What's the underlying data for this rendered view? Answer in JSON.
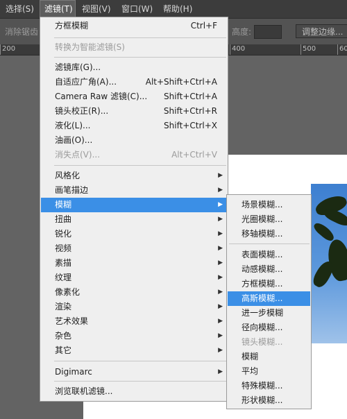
{
  "menubar": {
    "items": [
      {
        "label": "选择(S)"
      },
      {
        "label": "滤镜(T)"
      },
      {
        "label": "视图(V)"
      },
      {
        "label": "窗口(W)"
      },
      {
        "label": "帮助(H)"
      }
    ]
  },
  "options_bar": {
    "antialias_label": "消除锯齿",
    "height_label": "高度:",
    "height_value": "",
    "refine_edge_label": "调整边缘..."
  },
  "ruler": {
    "ticks": [
      "200",
      "400",
      "500",
      "600"
    ]
  },
  "filter_menu": {
    "last_filter": {
      "label": "方框模糊",
      "shortcut": "Ctrl+F"
    },
    "convert_smart": {
      "label": "转换为智能滤镜(S)"
    },
    "group1": [
      {
        "label": "滤镜库(G)...",
        "shortcut": ""
      },
      {
        "label": "自适应广角(A)...",
        "shortcut": "Alt+Shift+Ctrl+A"
      },
      {
        "label": "Camera Raw 滤镜(C)...",
        "shortcut": "Shift+Ctrl+A"
      },
      {
        "label": "镜头校正(R)...",
        "shortcut": "Shift+Ctrl+R"
      },
      {
        "label": "液化(L)...",
        "shortcut": "Shift+Ctrl+X"
      },
      {
        "label": "油画(O)...",
        "shortcut": ""
      },
      {
        "label": "消失点(V)...",
        "shortcut": "Alt+Ctrl+V"
      }
    ],
    "submenus": [
      {
        "label": "风格化"
      },
      {
        "label": "画笔描边"
      },
      {
        "label": "模糊"
      },
      {
        "label": "扭曲"
      },
      {
        "label": "锐化"
      },
      {
        "label": "视频"
      },
      {
        "label": "素描"
      },
      {
        "label": "纹理"
      },
      {
        "label": "像素化"
      },
      {
        "label": "渲染"
      },
      {
        "label": "艺术效果"
      },
      {
        "label": "杂色"
      },
      {
        "label": "其它"
      }
    ],
    "digimarc": {
      "label": "Digimarc"
    },
    "browse_online": {
      "label": "浏览联机滤镜..."
    }
  },
  "blur_menu": {
    "group1": [
      {
        "label": "场景模糊..."
      },
      {
        "label": "光圈模糊..."
      },
      {
        "label": "移轴模糊..."
      }
    ],
    "group2": [
      {
        "label": "表面模糊..."
      },
      {
        "label": "动感模糊..."
      },
      {
        "label": "方框模糊..."
      },
      {
        "label": "高斯模糊..."
      },
      {
        "label": "进一步模糊"
      },
      {
        "label": "径向模糊..."
      },
      {
        "label": "镜头模糊..."
      },
      {
        "label": "模糊"
      },
      {
        "label": "平均"
      },
      {
        "label": "特殊模糊..."
      },
      {
        "label": "形状模糊..."
      }
    ]
  },
  "colors": {
    "highlight": "#3b8fe6",
    "menu_bg": "#efefef",
    "app_bg": "#535353"
  }
}
